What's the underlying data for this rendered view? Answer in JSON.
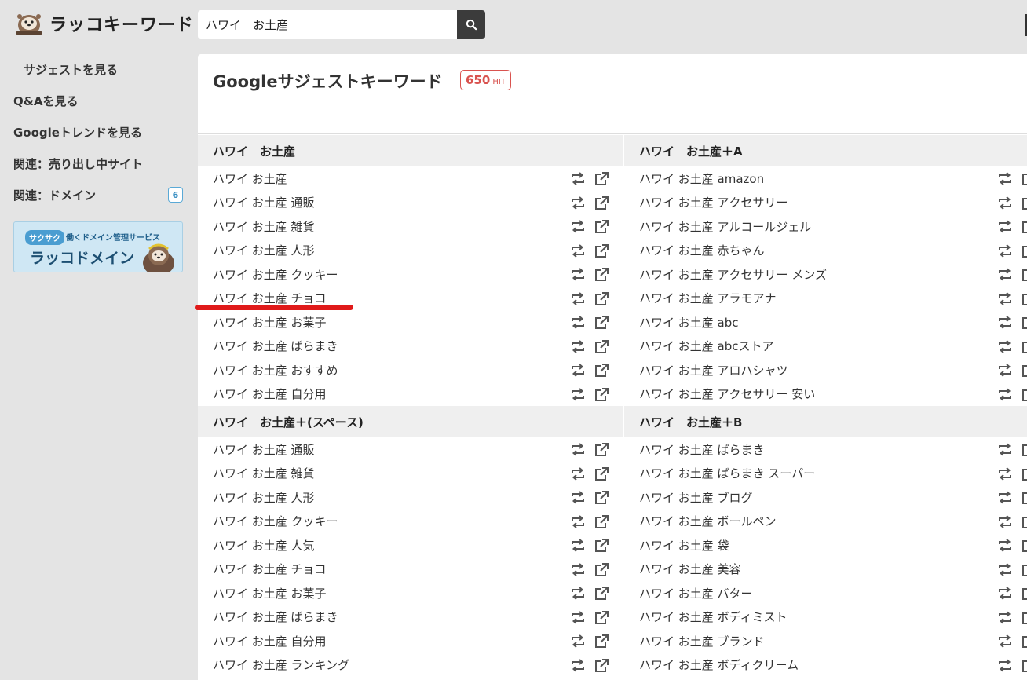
{
  "app": {
    "logo_text": "ラッコキーワード"
  },
  "search": {
    "value": "ハワイ　お土産"
  },
  "sidebar": {
    "items": [
      {
        "label": "サジェストを見る"
      },
      {
        "label": "Q&Aを見る"
      },
      {
        "label": "Googleトレンドを見る"
      },
      {
        "label": "関連：売り出し中サイト"
      },
      {
        "label": "関連：ドメイン",
        "badge": "6"
      }
    ],
    "banner": {
      "tag": "サクサク",
      "subtitle": "働くドメイン管理サービス",
      "title": "ラッコドメイン"
    }
  },
  "main": {
    "title": "Googleサジェストキーワード",
    "hit_count": "650",
    "hit_unit": "HIT",
    "groups_left": [
      {
        "heading": "ハワイ　お土産",
        "items": [
          "ハワイ お土産",
          "ハワイ お土産 通販",
          "ハワイ お土産 雑貨",
          "ハワイ お土産 人形",
          "ハワイ お土産 クッキー",
          "ハワイ お土産 チョコ",
          "ハワイ お土産 お菓子",
          "ハワイ お土産 ばらまき",
          "ハワイ お土産 おすすめ",
          "ハワイ お土産 自分用"
        ]
      },
      {
        "heading": "ハワイ　お土産＋(スペース)",
        "items": [
          "ハワイ お土産 通販",
          "ハワイ お土産 雑貨",
          "ハワイ お土産 人形",
          "ハワイ お土産 クッキー",
          "ハワイ お土産 人気",
          "ハワイ お土産 チョコ",
          "ハワイ お土産 お菓子",
          "ハワイ お土産 ばらまき",
          "ハワイ お土産 自分用",
          "ハワイ お土産 ランキング"
        ]
      }
    ],
    "groups_right": [
      {
        "heading": "ハワイ　お土産＋A",
        "items": [
          "ハワイ お土産 amazon",
          "ハワイ お土産 アクセサリー",
          "ハワイ お土産 アルコールジェル",
          "ハワイ お土産 赤ちゃん",
          "ハワイ お土産 アクセサリー メンズ",
          "ハワイ お土産 アラモアナ",
          "ハワイ お土産 abc",
          "ハワイ お土産 abcストア",
          "ハワイ お土産 アロハシャツ",
          "ハワイ お土産 アクセサリー 安い"
        ]
      },
      {
        "heading": "ハワイ　お土産＋B",
        "items": [
          "ハワイ お土産 ばらまき",
          "ハワイ お土産 ばらまき スーパー",
          "ハワイ お土産 ブログ",
          "ハワイ お土産 ボールペン",
          "ハワイ お土産 袋",
          "ハワイ お土産 美容",
          "ハワイ お土産 バター",
          "ハワイ お土産 ボディミスト",
          "ハワイ お土産 ブランド",
          "ハワイ お土産 ボディクリーム"
        ]
      }
    ]
  }
}
